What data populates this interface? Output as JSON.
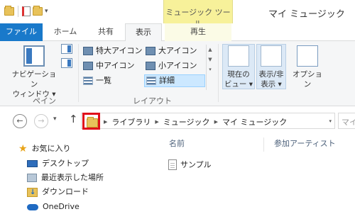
{
  "window": {
    "title": "マイ ミュージック",
    "context_tab_group": "ミュージック ツール"
  },
  "ribbon_tabs": {
    "file": "ファイル",
    "home": "ホーム",
    "share": "共有",
    "view": "表示",
    "play": "再生"
  },
  "ribbon": {
    "panes_group": {
      "label": "ペイン",
      "nav_pane_line1": "ナビゲーション",
      "nav_pane_line2": "ウィンドウ ▾"
    },
    "layout_group": {
      "label": "レイアウト",
      "items": [
        "特大アイコン",
        "大アイコン",
        "中アイコン",
        "小アイコン",
        "一覧",
        "詳細"
      ],
      "selected": "詳細"
    },
    "current_view": {
      "line1": "現在の",
      "line2": "ビュー ▾"
    },
    "show_hide": {
      "line1": "表示/非",
      "line2": "表示 ▾"
    },
    "options": "オプション"
  },
  "address_bar": {
    "path": [
      "ライブラリ",
      "ミュージック",
      "マイ ミュージック"
    ],
    "search_placeholder": "マイミ"
  },
  "nav_pane": {
    "items": [
      "お気に入り",
      "デスクトップ",
      "最近表示した場所",
      "ダウンロード",
      "OneDrive"
    ]
  },
  "content": {
    "columns": [
      "名前",
      "参加アーティスト"
    ],
    "files": [
      {
        "name": "サンプル"
      }
    ]
  },
  "colors": {
    "file_tab": "#1979ca",
    "context_tab": "#f7f19a",
    "highlight_box": "#e0101a",
    "selected_layout": "#cce8ff"
  }
}
